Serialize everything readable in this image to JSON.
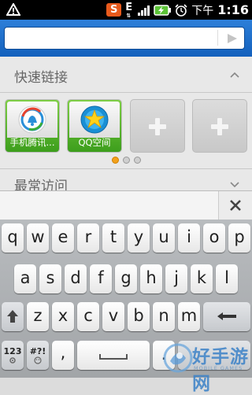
{
  "status_bar": {
    "time_prefix": "下午",
    "time": "1:16",
    "sogou_label": "S",
    "network_type": "E"
  },
  "search": {
    "placeholder": "",
    "value": ""
  },
  "quick_links": {
    "title": "快速链接",
    "tiles": [
      {
        "label": "手机腾讯...",
        "icon": "tencent-news-icon"
      },
      {
        "label": "QQ空间",
        "icon": "qzone-icon"
      }
    ],
    "page_count": 3,
    "active_page": 0
  },
  "recent": {
    "title": "最常访问"
  },
  "keyboard": {
    "row1": [
      "q",
      "w",
      "e",
      "r",
      "t",
      "y",
      "u",
      "i",
      "o",
      "p"
    ],
    "row2": [
      "a",
      "s",
      "d",
      "f",
      "g",
      "h",
      "j",
      "k",
      "l"
    ],
    "row3": [
      "z",
      "x",
      "c",
      "v",
      "b",
      "n",
      "m"
    ],
    "num_key": "123",
    "sym_key": "#?!",
    "comma_key": ","
  },
  "watermark": {
    "text": "好手游网",
    "sub": "MOBILE GAMES"
  }
}
